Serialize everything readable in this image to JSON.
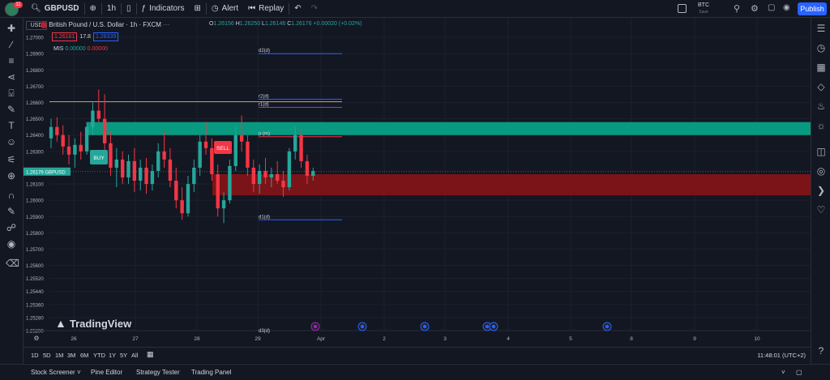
{
  "topbar": {
    "avatar_badge": "11",
    "symbol": "GBPUSD",
    "timeframe": "1h",
    "indicators_label": "Indicators",
    "alert_label": "Alert",
    "replay_label": "Replay",
    "layout_name": "BTC",
    "layout_status": "Save",
    "publish_label": "Publish"
  },
  "legend": {
    "currency": "USD",
    "title": "British Pound / U.S. Dollar · 1h · FXCM",
    "o_label": "O",
    "o": "1.26156",
    "h_label": "H",
    "h": "1.26250",
    "l_label": "L",
    "l": "1.26146",
    "c_label": "C",
    "c": "1.26176",
    "change": "+0.00020 (+0.02%)",
    "bid": "1.26161",
    "spread": "17.8",
    "ask": "1.26339",
    "indicator_name": "MIS",
    "indicator_v1": "0.00000",
    "indicator_v2": "0.00000"
  },
  "price_axis": {
    "ticks": [
      "1.27000",
      "1.26900",
      "1.26800",
      "1.26700",
      "1.26600",
      "1.26500",
      "1.26400",
      "1.26300",
      "1.26100",
      "1.26000",
      "1.25900",
      "1.25800",
      "1.25700",
      "1.25600",
      "1.25520",
      "1.25440",
      "1.25360",
      "1.25280",
      "1.25200"
    ],
    "last_price": "1.26176",
    "last_price_symbol": "GBPUSD"
  },
  "time_axis": {
    "ticks": [
      "26",
      "27",
      "28",
      "29",
      "Apr",
      "2",
      "3",
      "4",
      "5",
      "8",
      "9",
      "10"
    ]
  },
  "levels": {
    "d2": "d2(d)",
    "r2": "r2(d)",
    "r1": "r1(d)",
    "p": "p (m)",
    "d1": "d1(d)",
    "d3": "d3(d)"
  },
  "signals": {
    "buy": "BUY",
    "sell": "SELL"
  },
  "watermark": "TradingView",
  "timeframes": [
    "1D",
    "5D",
    "1M",
    "3M",
    "6M",
    "YTD",
    "1Y",
    "5Y",
    "All"
  ],
  "clock": "11:48:01 (UTC+2)",
  "bottom_tabs": [
    "Stock Screener",
    "Pine Editor",
    "Strategy Tester",
    "Trading Panel"
  ],
  "colors": {
    "bg": "#131722",
    "up": "#26a69a",
    "down": "#f23645",
    "demand_zone": "#089981",
    "supply_zone": "#7b1418",
    "accent": "#2962ff"
  },
  "chart_data": {
    "type": "candlestick",
    "symbol": "GBPUSD",
    "interval": "1h",
    "ohlc": [
      [
        1.2638,
        1.265,
        1.2632,
        1.2645
      ],
      [
        1.2645,
        1.2651,
        1.2636,
        1.264
      ],
      [
        1.264,
        1.2646,
        1.2628,
        1.2633
      ],
      [
        1.2633,
        1.264,
        1.2622,
        1.2628
      ],
      [
        1.2628,
        1.2638,
        1.262,
        1.2634
      ],
      [
        1.2634,
        1.2642,
        1.2625,
        1.263
      ],
      [
        1.263,
        1.2648,
        1.2628,
        1.2645
      ],
      [
        1.2645,
        1.266,
        1.264,
        1.2655
      ],
      [
        1.2655,
        1.2668,
        1.2648,
        1.265
      ],
      [
        1.265,
        1.2665,
        1.263,
        1.2635
      ],
      [
        1.2635,
        1.2642,
        1.2615,
        1.262
      ],
      [
        1.262,
        1.2632,
        1.2608,
        1.2625
      ],
      [
        1.2625,
        1.263,
        1.261,
        1.2614
      ],
      [
        1.2614,
        1.2628,
        1.261,
        1.2624
      ],
      [
        1.2624,
        1.2632,
        1.2605,
        1.2612
      ],
      [
        1.2612,
        1.2625,
        1.2606,
        1.262
      ],
      [
        1.262,
        1.2626,
        1.2604,
        1.261
      ],
      [
        1.261,
        1.2622,
        1.2606,
        1.2618
      ],
      [
        1.2618,
        1.2635,
        1.2614,
        1.263
      ],
      [
        1.263,
        1.2642,
        1.262,
        1.2625
      ],
      [
        1.2625,
        1.2632,
        1.2608,
        1.2612
      ],
      [
        1.2612,
        1.262,
        1.2595,
        1.26
      ],
      [
        1.26,
        1.2608,
        1.2588,
        1.2592
      ],
      [
        1.2592,
        1.2615,
        1.259,
        1.261
      ],
      [
        1.261,
        1.2625,
        1.2605,
        1.262
      ],
      [
        1.262,
        1.264,
        1.2615,
        1.2636
      ],
      [
        1.2636,
        1.2648,
        1.2628,
        1.2632
      ],
      [
        1.2632,
        1.2638,
        1.2612,
        1.2616
      ],
      [
        1.2616,
        1.2622,
        1.259,
        1.2595
      ],
      [
        1.2595,
        1.2605,
        1.2586,
        1.26
      ],
      [
        1.26,
        1.2625,
        1.2598,
        1.2621
      ],
      [
        1.2621,
        1.2645,
        1.2618,
        1.264
      ],
      [
        1.264,
        1.2652,
        1.263,
        1.2636
      ],
      [
        1.2636,
        1.264,
        1.2615,
        1.262
      ],
      [
        1.262,
        1.2625,
        1.2605,
        1.261
      ],
      [
        1.261,
        1.2622,
        1.2604,
        1.2618
      ],
      [
        1.2618,
        1.2626,
        1.261,
        1.2614
      ],
      [
        1.2614,
        1.262,
        1.2608,
        1.2616
      ],
      [
        1.2616,
        1.2624,
        1.261,
        1.2612
      ],
      [
        1.2612,
        1.2618,
        1.2602,
        1.2608
      ],
      [
        1.2608,
        1.2632,
        1.2606,
        1.263
      ],
      [
        1.263,
        1.2645,
        1.2625,
        1.264
      ],
      [
        1.264,
        1.2644,
        1.262,
        1.2624
      ],
      [
        1.2624,
        1.2628,
        1.261,
        1.2615
      ],
      [
        1.2615,
        1.262,
        1.2612,
        1.2618
      ]
    ],
    "zones": [
      {
        "kind": "demand",
        "from": 1.264,
        "to": 1.2648
      },
      {
        "kind": "supply",
        "from": 1.2603,
        "to": 1.2616
      }
    ],
    "pivot_levels": {
      "d2(d)": 1.269,
      "r2(d)": 1.2662,
      "r1(d)": 1.2657,
      "p (m)": 1.2639,
      "d1(d)": 1.2588
    },
    "ylim": [
      1.252,
      1.271
    ]
  }
}
